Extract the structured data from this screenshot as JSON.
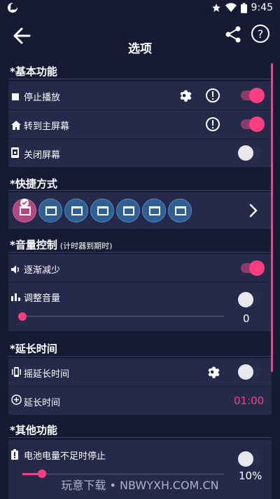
{
  "status_bar": {
    "time": "9:45",
    "icons": [
      "moon-icon",
      "star-icon",
      "wifi-icon",
      "battery-icon"
    ]
  },
  "app_bar": {
    "title": "选项",
    "back_icon": "arrow-left-icon",
    "share_icon": "share-icon",
    "help_icon": "help-circle-icon"
  },
  "sections": {
    "basic": {
      "header": "*基本功能",
      "rows": [
        {
          "label": "停止播放",
          "icon": "stop-square-icon",
          "has_settings": true,
          "has_info": true,
          "toggle": true
        },
        {
          "label": "转到主屏幕",
          "icon": "home-icon",
          "has_info": true,
          "toggle": true
        },
        {
          "label": "关闭屏幕",
          "icon": "phone-lock-icon",
          "toggle": false
        }
      ]
    },
    "shortcuts": {
      "header": "*快捷方式",
      "count": 7,
      "active_index": 0,
      "chevron_icon": "chevron-right-icon"
    },
    "volume": {
      "header": "*音量控制",
      "subheader": "(计时器到期时)",
      "fade": {
        "label": "逐渐减少",
        "icon": "speaker-icon",
        "toggle": true
      },
      "adjust": {
        "label": "调整音量",
        "icon": "bars-icon",
        "toggle": false,
        "value": "0",
        "slider_fraction": 0.0
      }
    },
    "extend": {
      "header": "*延长时间",
      "shake": {
        "label": "摇延长时间",
        "icon": "vibrate-icon",
        "toggle": false
      },
      "extend_time": {
        "label": "延长时间",
        "icon": "plus-circle-icon",
        "value": "01:00"
      }
    },
    "other": {
      "header": "*其他功能",
      "battery": {
        "label": "电池电量不足时停止",
        "icon": "battery-alert-icon",
        "toggle": false,
        "value": "10%",
        "slider_fraction": 0.1
      }
    }
  },
  "watermark": "玩意下载 • NBWYXH.COM.CN",
  "colors": {
    "background": "#171a33",
    "card": "#262a4a",
    "accent": "#ff3d7f",
    "shortcut": "#2f5f94"
  }
}
